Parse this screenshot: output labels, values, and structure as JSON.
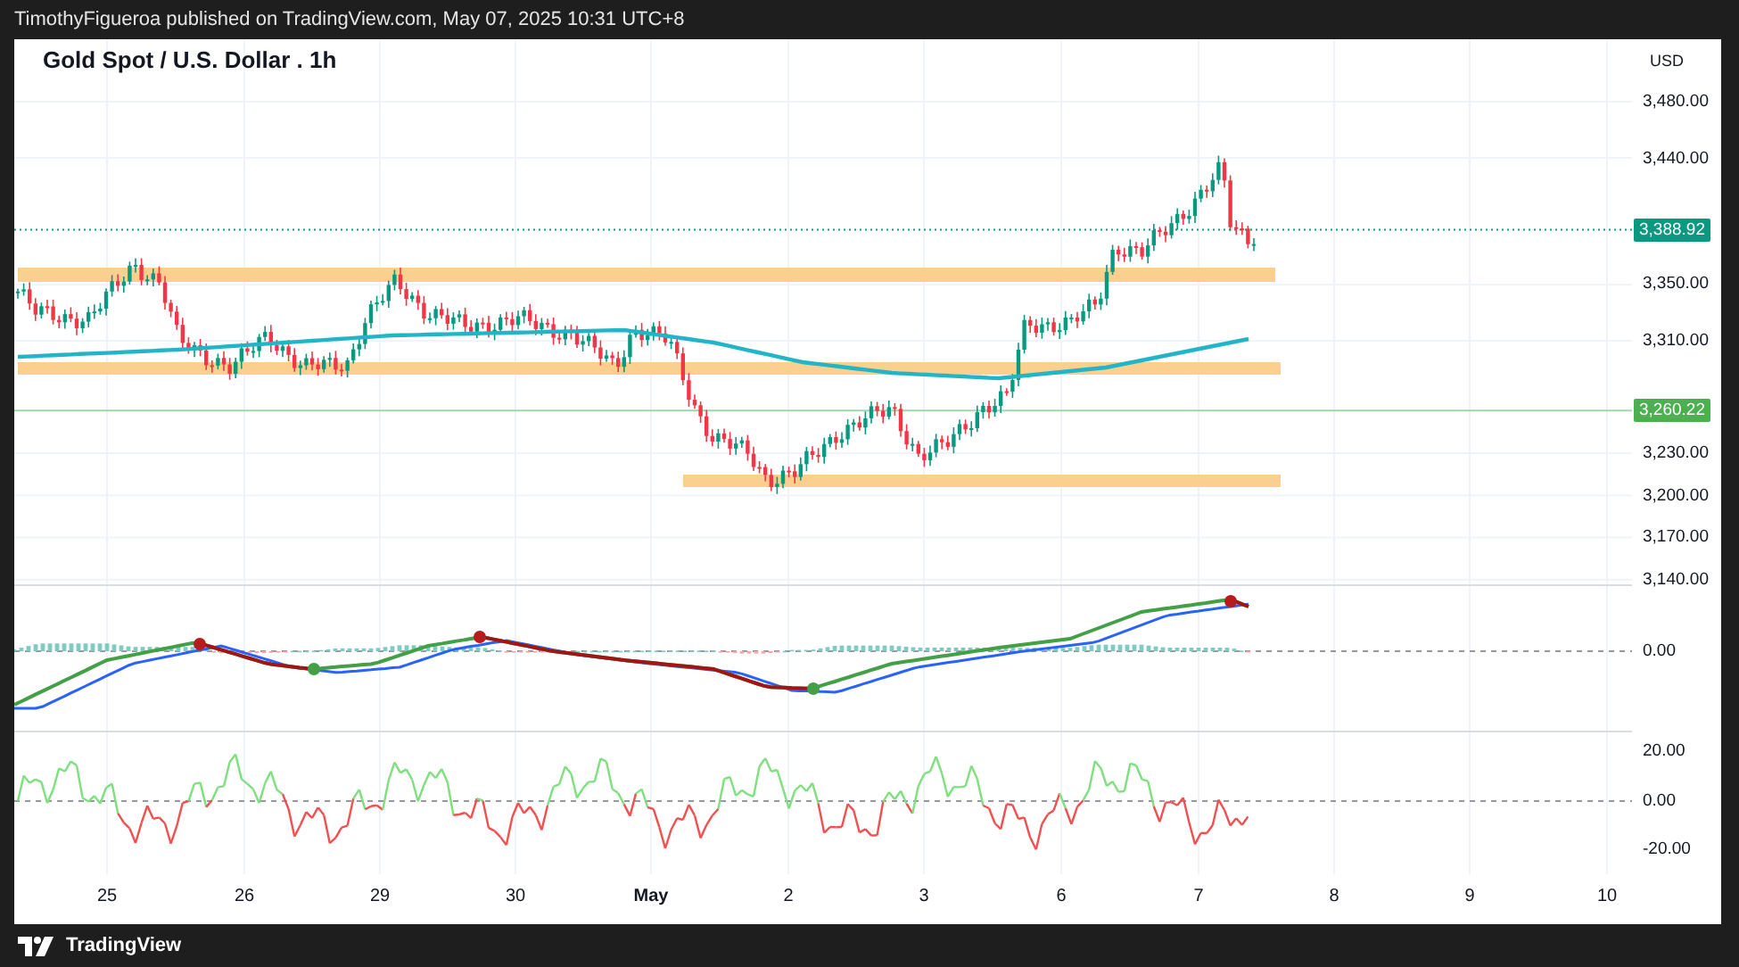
{
  "header": {
    "text": "TimothyFigueroa published on TradingView.com, May 07, 2025 10:31 UTC+8"
  },
  "chart": {
    "title": "Gold Spot / U.S. Dollar . 1h",
    "currency": "USD",
    "price_ticks": [
      "3,480.00",
      "3,440.00",
      "3,350.00",
      "3,310.00",
      "3,230.00",
      "3,200.00",
      "3,170.00",
      "3,140.00"
    ],
    "price_labels": [
      {
        "text": "3,388.92",
        "color": "#089981"
      },
      {
        "text": "3,260.22",
        "color": "#4caf50"
      }
    ],
    "macd_ticks": [
      "0.00"
    ],
    "oscillator_ticks": [
      "20.00",
      "0.00",
      "-20.00"
    ],
    "time_labels": [
      {
        "text": "25",
        "kind": "day"
      },
      {
        "text": "26",
        "kind": "day"
      },
      {
        "text": "29",
        "kind": "day"
      },
      {
        "text": "30",
        "kind": "day"
      },
      {
        "text": "May",
        "kind": "month"
      },
      {
        "text": "2",
        "kind": "day"
      },
      {
        "text": "3",
        "kind": "day"
      },
      {
        "text": "6",
        "kind": "day"
      },
      {
        "text": "7",
        "kind": "day"
      },
      {
        "text": "8",
        "kind": "day"
      },
      {
        "text": "9",
        "kind": "day"
      },
      {
        "text": "10",
        "kind": "day"
      }
    ]
  },
  "footer": {
    "brand": "TradingView"
  }
}
